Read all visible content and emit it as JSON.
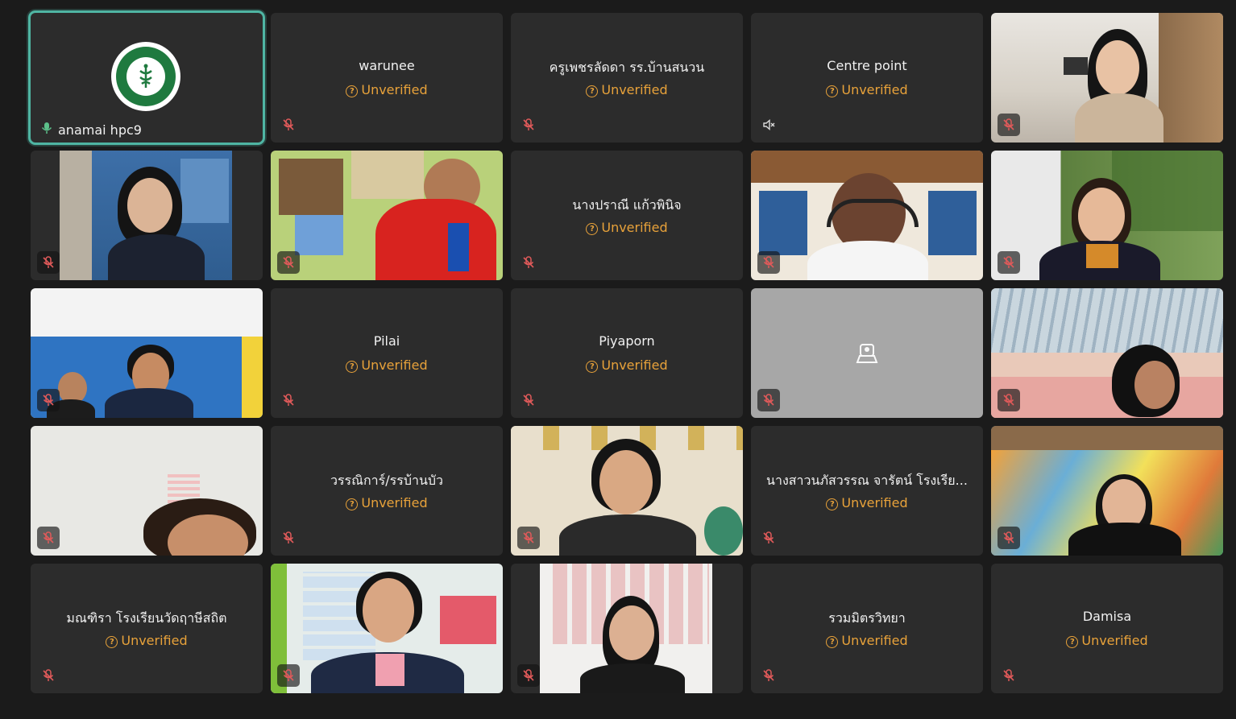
{
  "tiles": [
    {
      "name": "anamai hpc9",
      "type": "logo",
      "logo_text": "กระทรวงสาธารณสุข · MINISTRY OF PUBLIC HEALTH",
      "mic": "on"
    },
    {
      "name": "warunee",
      "type": "text",
      "status": "Unverified",
      "mic": "muted"
    },
    {
      "name": "ครูเพชรลัดดา รร.บ้านสนวน",
      "type": "text",
      "status": "Unverified",
      "mic": "muted"
    },
    {
      "name": "Centre point",
      "type": "text",
      "status": "Unverified",
      "mic": "speaker-off"
    },
    {
      "type": "video",
      "mic": "muted"
    },
    {
      "type": "video",
      "mic": "muted"
    },
    {
      "type": "video",
      "mic": "muted"
    },
    {
      "name": "นางปราณี  แก้วพินิจ",
      "type": "text",
      "status": "Unverified",
      "mic": "muted"
    },
    {
      "type": "video",
      "mic": "muted"
    },
    {
      "type": "video",
      "mic": "muted"
    },
    {
      "type": "video",
      "mic": "muted"
    },
    {
      "name": "Pilai",
      "type": "text",
      "status": "Unverified",
      "mic": "muted"
    },
    {
      "name": "Piyaporn",
      "type": "text",
      "status": "Unverified",
      "mic": "muted"
    },
    {
      "type": "camera-off",
      "mic": "muted"
    },
    {
      "type": "video",
      "mic": "muted"
    },
    {
      "type": "video",
      "mic": "muted"
    },
    {
      "name": "วรรณิการ์/รรบ้านบัว",
      "type": "text",
      "status": "Unverified",
      "mic": "muted"
    },
    {
      "type": "video",
      "mic": "muted"
    },
    {
      "name": "นางสาวนภัสวรรณ  จารัตน์ โรงเรีย...",
      "type": "text",
      "status": "Unverified",
      "mic": "muted"
    },
    {
      "type": "video",
      "mic": "muted"
    },
    {
      "name": "มณฑิรา โรงเรียนวัดฤาษีสถิต",
      "type": "text",
      "status": "Unverified",
      "mic": "muted"
    },
    {
      "type": "video",
      "mic": "muted"
    },
    {
      "type": "video",
      "mic": "muted"
    },
    {
      "name": "รวมมิตรวิทยา",
      "type": "text",
      "status": "Unverified",
      "mic": "muted"
    },
    {
      "name": "Damisa",
      "type": "text",
      "status": "Unverified",
      "mic": "muted"
    }
  ],
  "colors": {
    "background": "#1b1b1b",
    "tile": "#2c2c2c",
    "unverified": "#e8a23a",
    "active_border": "#4fb5a3"
  }
}
